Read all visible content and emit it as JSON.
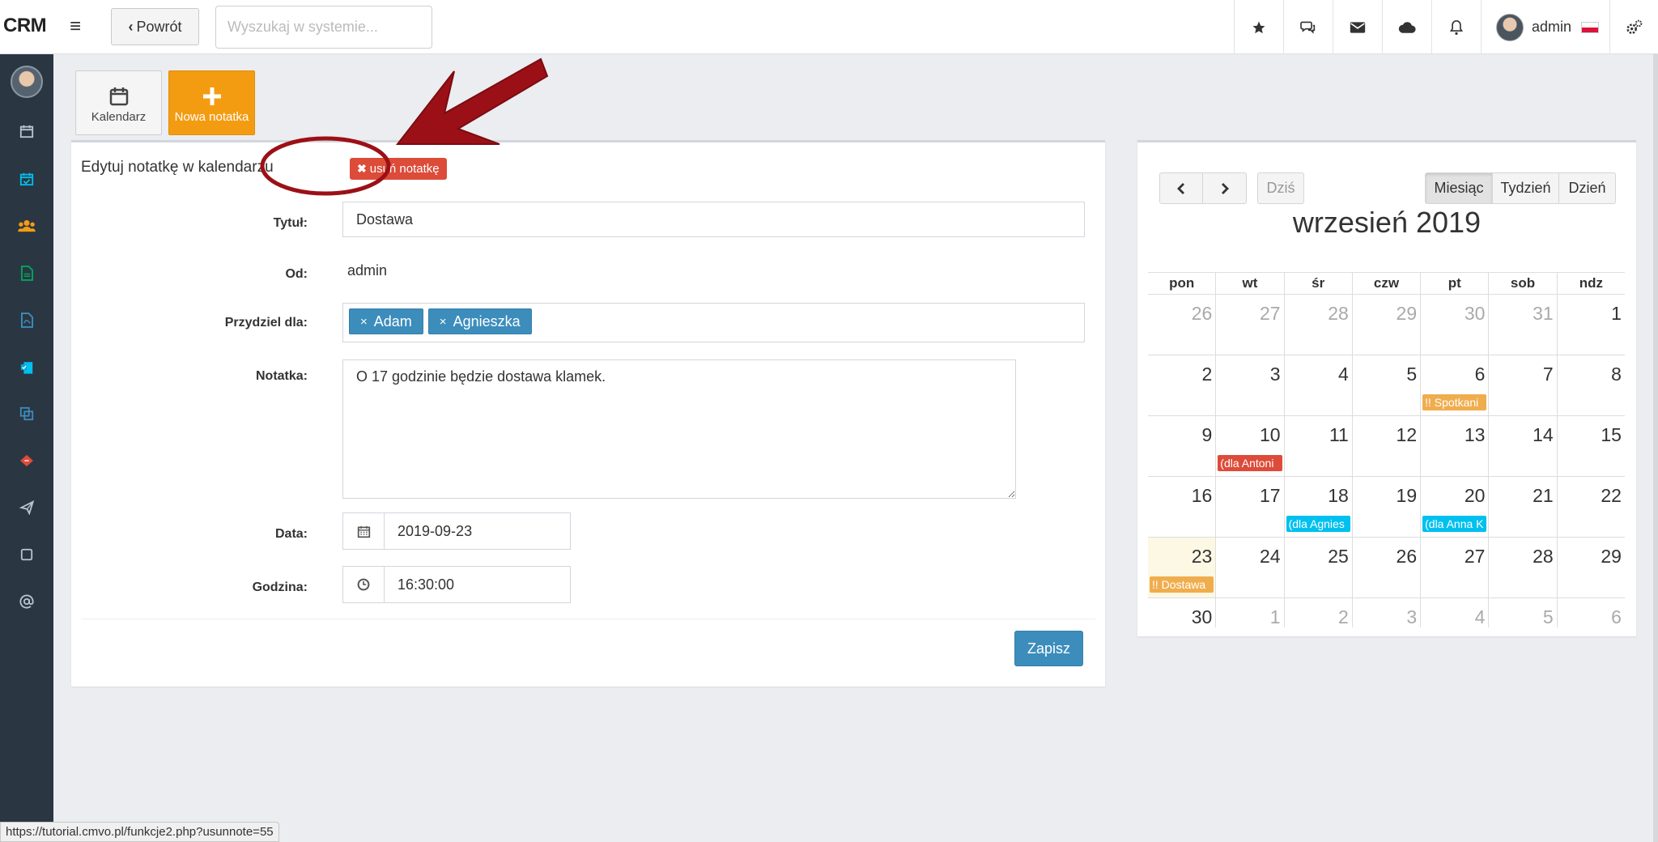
{
  "app": {
    "logo": "CRM"
  },
  "header": {
    "back_label": "Powrót",
    "search_placeholder": "Wyszukaj w systemie...",
    "user_name": "admin",
    "icons": [
      "star-icon",
      "comments-icon",
      "envelope-icon",
      "cloud-icon",
      "bell-icon",
      "cogs-icon"
    ]
  },
  "sidebar": {
    "icons": [
      "calendar-icon",
      "calendar-check-icon",
      "users-icon",
      "document-icon",
      "pdf-icon",
      "clipboard-icon",
      "copy-icon",
      "ticket-icon",
      "paper-plane-icon",
      "square-icon",
      "at-icon"
    ]
  },
  "toolbar": {
    "calendar_label": "Kalendarz",
    "new_note_label": "Nowa notatka"
  },
  "form": {
    "title": "Edytuj notatkę w kalendarzu",
    "delete_label": "usuń notatkę",
    "fields": {
      "title_label": "Tytuł:",
      "title_value": "Dostawa",
      "from_label": "Od:",
      "from_value": "admin",
      "assign_label": "Przydziel dla:",
      "assignees": [
        "Adam",
        "Agnieszka"
      ],
      "note_label": "Notatka:",
      "note_value": "O 17 godzinie będzie dostawa klamek.",
      "date_label": "Data:",
      "date_value": "2019-09-23",
      "time_label": "Godzina:",
      "time_value": "16:30:00"
    },
    "save_label": "Zapisz"
  },
  "calendar": {
    "today_label": "Dziś",
    "views": [
      "Miesiąc",
      "Tydzień",
      "Dzień"
    ],
    "active_view": "Miesiąc",
    "title": "wrzesień 2019",
    "weekdays": [
      "pon",
      "wt",
      "śr",
      "czw",
      "pt",
      "sob",
      "ndz"
    ],
    "weeks": [
      [
        "26",
        "27",
        "28",
        "29",
        "30",
        "31",
        "1"
      ],
      [
        "2",
        "3",
        "4",
        "5",
        "6",
        "7",
        "8"
      ],
      [
        "9",
        "10",
        "11",
        "12",
        "13",
        "14",
        "15"
      ],
      [
        "16",
        "17",
        "18",
        "19",
        "20",
        "21",
        "22"
      ],
      [
        "23",
        "24",
        "25",
        "26",
        "27",
        "28",
        "29"
      ],
      [
        "30",
        "1",
        "2",
        "3",
        "4",
        "5",
        "6"
      ]
    ],
    "events": [
      {
        "week": 1,
        "day": 4,
        "text": "!! Spotkani",
        "color": "#f0ad4e"
      },
      {
        "week": 2,
        "day": 1,
        "text": "(dla Antoni",
        "color": "#dd4b39"
      },
      {
        "week": 3,
        "day": 2,
        "text": "(dla Agnies",
        "color": "#00c0ef"
      },
      {
        "week": 3,
        "day": 4,
        "text": "(dla Anna K",
        "color": "#00c0ef"
      },
      {
        "week": 4,
        "day": 0,
        "text": "!! Dostawa",
        "color": "#f0ad4e"
      }
    ]
  },
  "status_url": "https://tutorial.cmvo.pl/funkcje2.php?usunnote=55",
  "colors": {
    "sidebar": "#2b3643",
    "primary": "#3c8dbc",
    "danger": "#dd4b39",
    "warning": "#f39c12",
    "annotation": "#9b1016"
  }
}
